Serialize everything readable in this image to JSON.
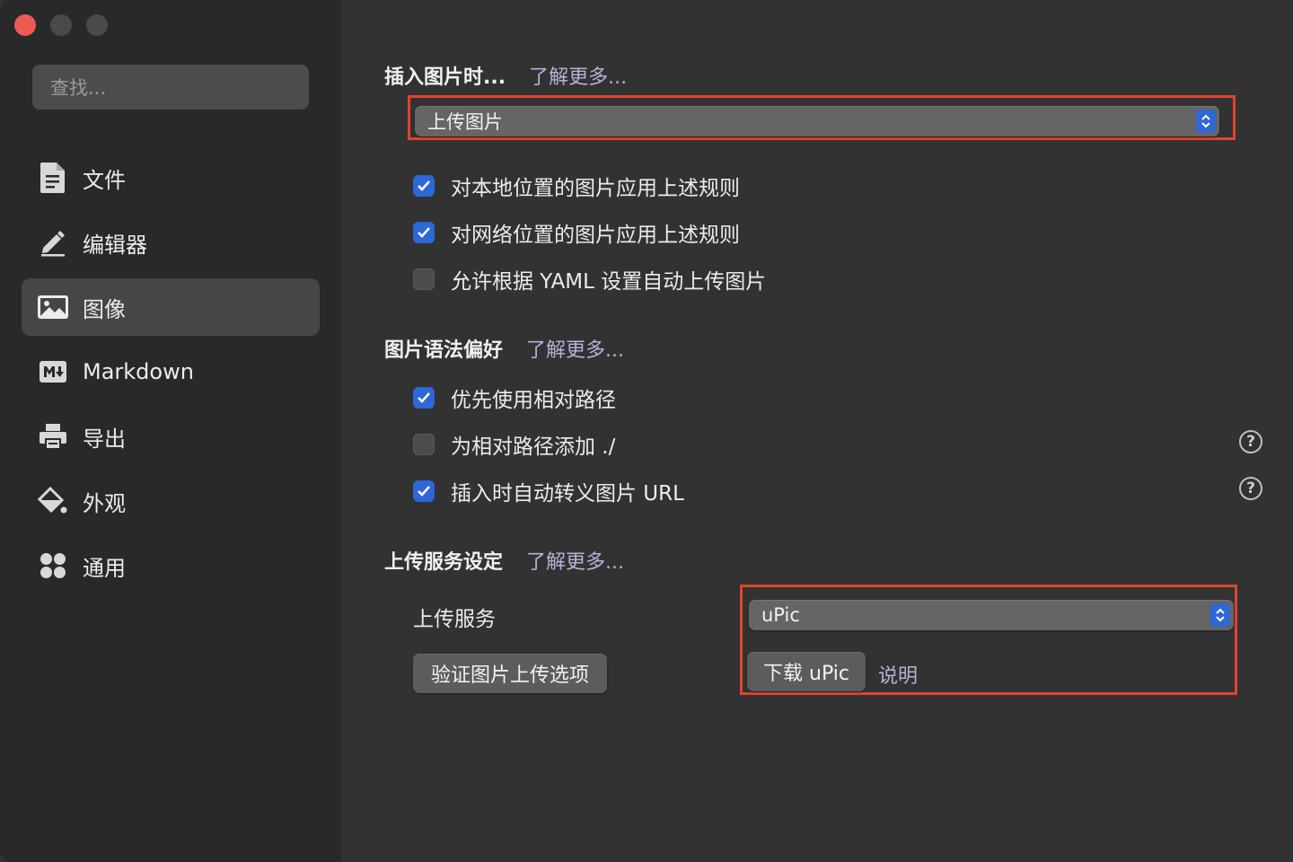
{
  "sidebar": {
    "search_placeholder": "查找...",
    "items": [
      {
        "label": "文件",
        "icon": "document-icon"
      },
      {
        "label": "编辑器",
        "icon": "pencil-icon"
      },
      {
        "label": "图像",
        "icon": "image-icon",
        "active": true
      },
      {
        "label": "Markdown",
        "icon": "markdown-icon"
      },
      {
        "label": "导出",
        "icon": "printer-icon"
      },
      {
        "label": "外观",
        "icon": "paint-bucket-icon"
      },
      {
        "label": "通用",
        "icon": "grid-icon"
      }
    ]
  },
  "insert_image": {
    "title": "插入图片时...",
    "learn_more": "了解更多...",
    "selected_action": "上传图片",
    "options": [
      {
        "label": "对本地位置的图片应用上述规则",
        "checked": true
      },
      {
        "label": "对网络位置的图片应用上述规则",
        "checked": true
      },
      {
        "label": "允许根据 YAML 设置自动上传图片",
        "checked": false
      }
    ]
  },
  "image_syntax": {
    "title": "图片语法偏好",
    "learn_more": "了解更多...",
    "options": [
      {
        "label": "优先使用相对路径",
        "checked": true,
        "help": false
      },
      {
        "label": "为相对路径添加 ./",
        "checked": false,
        "help": true
      },
      {
        "label": "插入时自动转义图片 URL",
        "checked": true,
        "help": true
      }
    ]
  },
  "upload_service": {
    "title": "上传服务设定",
    "learn_more": "了解更多...",
    "service_label": "上传服务",
    "service_value": "uPic",
    "verify_button": "验证图片上传选项",
    "download_button": "下载 uPic",
    "instructions_link": "说明"
  },
  "colors": {
    "accent": "#2e67d6",
    "highlight_border": "#e0442f",
    "close_button": "#ed5a53"
  }
}
